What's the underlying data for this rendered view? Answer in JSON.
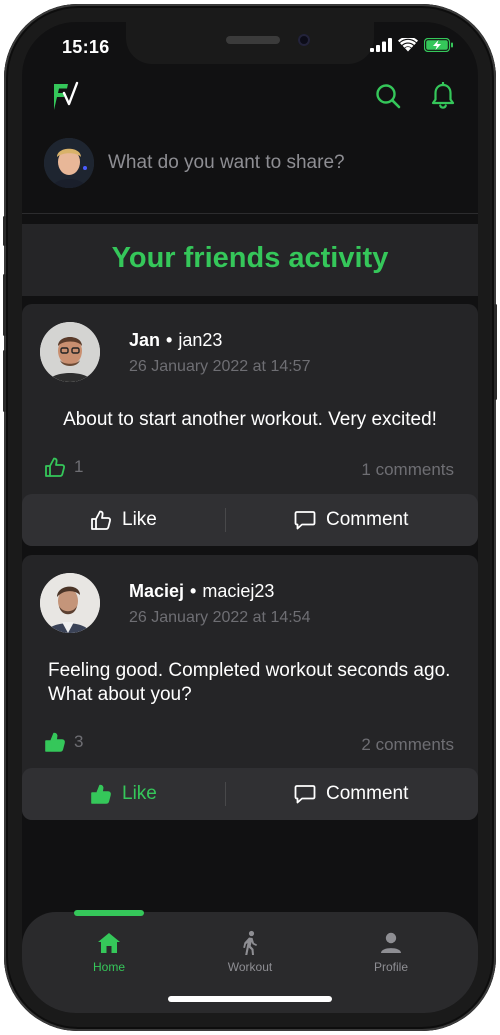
{
  "status_bar": {
    "time": "15:16",
    "icons": [
      "signal-icon",
      "wifi-icon",
      "battery-charging-icon"
    ]
  },
  "top_bar": {
    "logo": "FV",
    "icons": [
      "search-icon",
      "bell-icon"
    ]
  },
  "composer": {
    "placeholder": "What do you want to share?"
  },
  "activity": {
    "title": "Your friends activity"
  },
  "posts": [
    {
      "name": "Jan",
      "handle": "jan23",
      "date": "26 January 2022 at 14:57",
      "body": "About to start another workout. Very excited!",
      "likes": "1",
      "comments": "1 comments",
      "liked": false,
      "like_label": "Like",
      "comment_label": "Comment"
    },
    {
      "name": "Maciej",
      "handle": "maciej23",
      "date": "26 January 2022 at 14:54",
      "body": "Feeling good. Completed workout seconds ago. What about you?",
      "likes": "3",
      "comments": "2 comments",
      "liked": true,
      "like_label": "Like",
      "comment_label": "Comment"
    }
  ],
  "tabs": [
    {
      "label": "Home",
      "icon": "home-icon",
      "active": true
    },
    {
      "label": "Workout",
      "icon": "walking-icon",
      "active": false
    },
    {
      "label": "Profile",
      "icon": "person-icon",
      "active": false
    }
  ],
  "colors": {
    "accent": "#35c75a",
    "background": "#111112",
    "card": "#252527",
    "muted": "#6e6e73"
  }
}
